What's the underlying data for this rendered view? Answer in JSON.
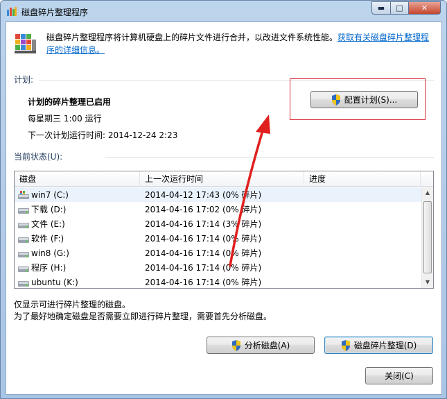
{
  "window": {
    "title": "磁盘碎片整理程序",
    "minimize_glyph": "▬",
    "maximize_glyph": "□",
    "close_glyph": "✕"
  },
  "header": {
    "description": "磁盘碎片整理程序将计算机硬盘上的碎片文件进行合并，以改进文件系统性能。",
    "link_text": "获取有关磁盘碎片整理程序的详细信息。"
  },
  "schedule": {
    "group_label": "计划:",
    "status": "计划的碎片整理已启用",
    "frequency": "每星期三  1:00 运行",
    "next_run": "下一次计划运行时间: 2014-12-24 2:23",
    "configure_button": "配置计划(S)..."
  },
  "current_status": {
    "group_label": "当前状态(U):",
    "columns": [
      "磁盘",
      "上一次运行时间",
      "进度"
    ],
    "rows": [
      {
        "disk": "win7 (C:)",
        "last_run": "2014-04-12 17:43 (0% 碎片)",
        "icon": "windows-drive-icon"
      },
      {
        "disk": "下载 (D:)",
        "last_run": "2014-04-16 17:02 (0% 碎片)",
        "icon": "drive-icon"
      },
      {
        "disk": "文件 (E:)",
        "last_run": "2014-04-16 17:14 (3% 碎片)",
        "icon": "drive-icon"
      },
      {
        "disk": "软件 (F:)",
        "last_run": "2014-04-16 17:14 (0% 碎片)",
        "icon": "drive-icon"
      },
      {
        "disk": "win8 (G:)",
        "last_run": "2014-04-16 17:14 (0% 碎片)",
        "icon": "drive-icon"
      },
      {
        "disk": "程序 (H:)",
        "last_run": "2014-04-16 17:14 (0% 碎片)",
        "icon": "drive-icon"
      },
      {
        "disk": "ubuntu (K:)",
        "last_run": "2014-04-16 17:14 (0% 碎片)",
        "icon": "drive-icon"
      }
    ]
  },
  "notes": {
    "line1": "仅显示可进行碎片整理的磁盘。",
    "line2": "为了最好地确定磁盘是否需要立即进行碎片整理，需要首先分析磁盘。"
  },
  "actions": {
    "analyze_button": "分析磁盘(A)",
    "defrag_button": "磁盘碎片整理(D)",
    "close_button": "关闭(C)"
  },
  "colors": {
    "annotation_red": "#d9282f",
    "link_blue": "#0066cc"
  }
}
